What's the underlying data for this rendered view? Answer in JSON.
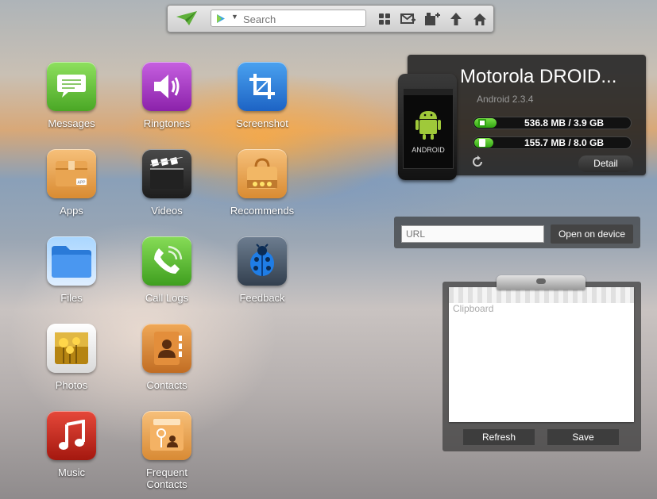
{
  "toolbar": {
    "search_placeholder": "Search",
    "icons": [
      "airdroid-logo-icon",
      "play-store-icon",
      "grid-icon",
      "compose-message-icon",
      "add-app-icon",
      "upload-icon",
      "home-icon"
    ]
  },
  "apps": [
    {
      "label": "Messages",
      "icon": "messages-icon",
      "color": "#6cc642"
    },
    {
      "label": "Ringtones",
      "icon": "speaker-icon",
      "color": "#a63ec6"
    },
    {
      "label": "Screenshot",
      "icon": "crop-icon",
      "color": "#2f7fdd"
    },
    {
      "label": "Apps",
      "icon": "app-box-icon",
      "color": "#e8a049"
    },
    {
      "label": "Videos",
      "icon": "clapperboard-icon",
      "color": "#2b2b2b"
    },
    {
      "label": "Recommends",
      "icon": "shopping-bag-icon",
      "color": "#e8a049"
    },
    {
      "label": "Files",
      "icon": "folder-icon",
      "color": "#3e8be0"
    },
    {
      "label": "Call Logs",
      "icon": "phone-icon",
      "color": "#5cbf3e"
    },
    {
      "label": "Feedback",
      "icon": "ladybug-icon",
      "color": "#3c4b5e"
    },
    {
      "label": "Photos",
      "icon": "photo-icon",
      "color": "#f0f0f0"
    },
    {
      "label": "Contacts",
      "icon": "contacts-book-icon",
      "color": "#d7873e"
    },
    {
      "label": "Music",
      "icon": "music-note-icon",
      "color": "#cc2a1e"
    },
    {
      "label": "Frequent\nContacts",
      "label_line1": "Frequent",
      "label_line2": "Contacts",
      "icon": "frequent-contacts-icon",
      "color": "#eaa44d"
    }
  ],
  "device": {
    "name": "Motorola DROID...",
    "android_version": "Android 2.3.4",
    "phone_logo": "ANDROID",
    "storage": [
      {
        "text": "536.8 MB / 3.9 GB",
        "used_fraction": 0.14,
        "icon": "phone-storage-icon"
      },
      {
        "text": "155.7 MB / 8.0 GB",
        "used_fraction": 0.02,
        "icon": "sd-card-icon"
      }
    ],
    "detail_label": "Detail"
  },
  "url_panel": {
    "placeholder": "URL",
    "open_label": "Open on device"
  },
  "clipboard": {
    "placeholder": "Clipboard",
    "refresh_label": "Refresh",
    "save_label": "Save"
  }
}
